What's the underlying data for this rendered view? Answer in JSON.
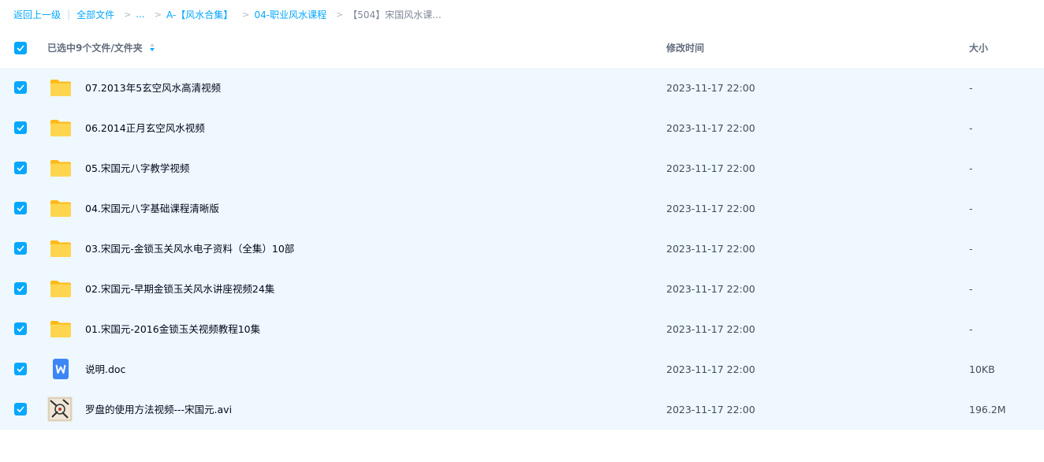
{
  "breadcrumb": {
    "back": "返回上一级",
    "all_files": "全部文件",
    "ellipsis": "...",
    "level1": "A-【风水合集】",
    "level2": "04-职业风水课程",
    "current": "【504】宋国风水课..."
  },
  "header": {
    "selection": "已选中9个文件/文件夹",
    "modified": "修改时间",
    "size": "大小"
  },
  "colors": {
    "accent": "#06a7ff",
    "row_selected_bg": "#eef8fe",
    "folder": "#ffc933"
  },
  "files": [
    {
      "name": "07.2013年5玄空风水高清视频",
      "time": "2023-11-17 22:00",
      "size": "-",
      "icon": "folder-icon"
    },
    {
      "name": "06.2014正月玄空风水视频",
      "time": "2023-11-17 22:00",
      "size": "-",
      "icon": "folder-icon"
    },
    {
      "name": "05.宋国元八字教学视频",
      "time": "2023-11-17 22:00",
      "size": "-",
      "icon": "folder-icon"
    },
    {
      "name": "04.宋国元八字基础课程清晰版",
      "time": "2023-11-17 22:00",
      "size": "-",
      "icon": "folder-icon"
    },
    {
      "name": "03.宋国元-金锁玉关风水电子资料（全集）10部",
      "time": "2023-11-17 22:00",
      "size": "-",
      "icon": "folder-icon"
    },
    {
      "name": "02.宋国元-早期金锁玉关风水讲座视频24集",
      "time": "2023-11-17 22:00",
      "size": "-",
      "icon": "folder-icon"
    },
    {
      "name": "01.宋国元-2016金锁玉关视频教程10集",
      "time": "2023-11-17 22:00",
      "size": "-",
      "icon": "folder-icon"
    },
    {
      "name": "说明.doc",
      "time": "2023-11-17 22:00",
      "size": "10KB",
      "icon": "word-doc-icon"
    },
    {
      "name": "罗盘的使用方法视频---宋国元.avi",
      "time": "2023-11-17 22:00",
      "size": "196.2M",
      "icon": "video-thumbnail-icon"
    }
  ]
}
